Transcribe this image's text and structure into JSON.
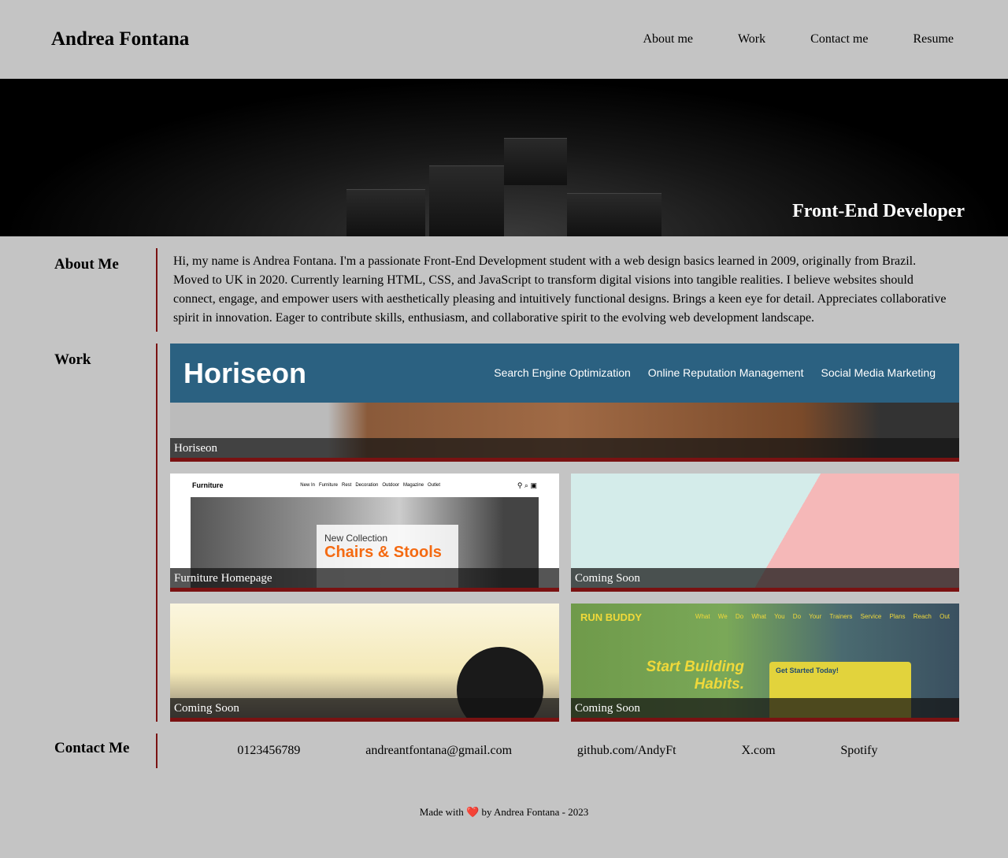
{
  "header": {
    "name": "Andrea Fontana",
    "nav": [
      "About me",
      "Work",
      "Contact me",
      "Resume"
    ]
  },
  "hero": {
    "title": "Front-End Developer"
  },
  "about": {
    "heading": "About Me",
    "text": "Hi, my name is Andrea Fontana. I'm a passionate Front-End Development student with a web design basics learned in 2009, originally from Brazil. Moved to UK in 2020. Currently learning HTML, CSS, and JavaScript to transform digital visions into tangible realities. I believe websites should connect, engage, and empower users with aesthetically pleasing and intuitively functional designs. Brings a keen eye for detail. Appreciates collaborative spirit in innovation. Eager to contribute skills, enthusiasm, and collaborative spirit to the evolving web development landscape."
  },
  "work": {
    "heading": "Work",
    "horiseon": {
      "caption": "Horiseon",
      "logo": "Horiseon",
      "nav": [
        "Search Engine Optimization",
        "Online Reputation Management",
        "Social Media Marketing"
      ]
    },
    "furniture": {
      "caption": "Furniture Homepage",
      "logo": "Furniture",
      "nav": "New In   Furniture   Rest   Decoration   Outdoor   Magazine   Outlet",
      "kicker": "New Collection",
      "headline": "Chairs & Stools"
    },
    "soon1": {
      "caption": "Coming Soon"
    },
    "soon2": {
      "caption": "Coming Soon"
    },
    "runbuddy": {
      "caption": "Coming Soon",
      "logo": "RUN BUDDY",
      "nav": "What We Do  What You Do  Your Trainers  Service Plans  Reach Out",
      "headline": "Start Building Habits.",
      "form_title": "Get Started Today!"
    }
  },
  "contact": {
    "heading": "Contact Me",
    "items": [
      "0123456789",
      "andreantfontana@gmail.com",
      "github.com/AndyFt",
      "X.com",
      "Spotify"
    ]
  },
  "footer": {
    "before": "Made with ",
    "heart": "❤️",
    "after": " by Andrea Fontana - 2023"
  },
  "colors": {
    "accent": "#7a1212",
    "background": "#c4c4c4",
    "horiseon": "#2b6181"
  }
}
